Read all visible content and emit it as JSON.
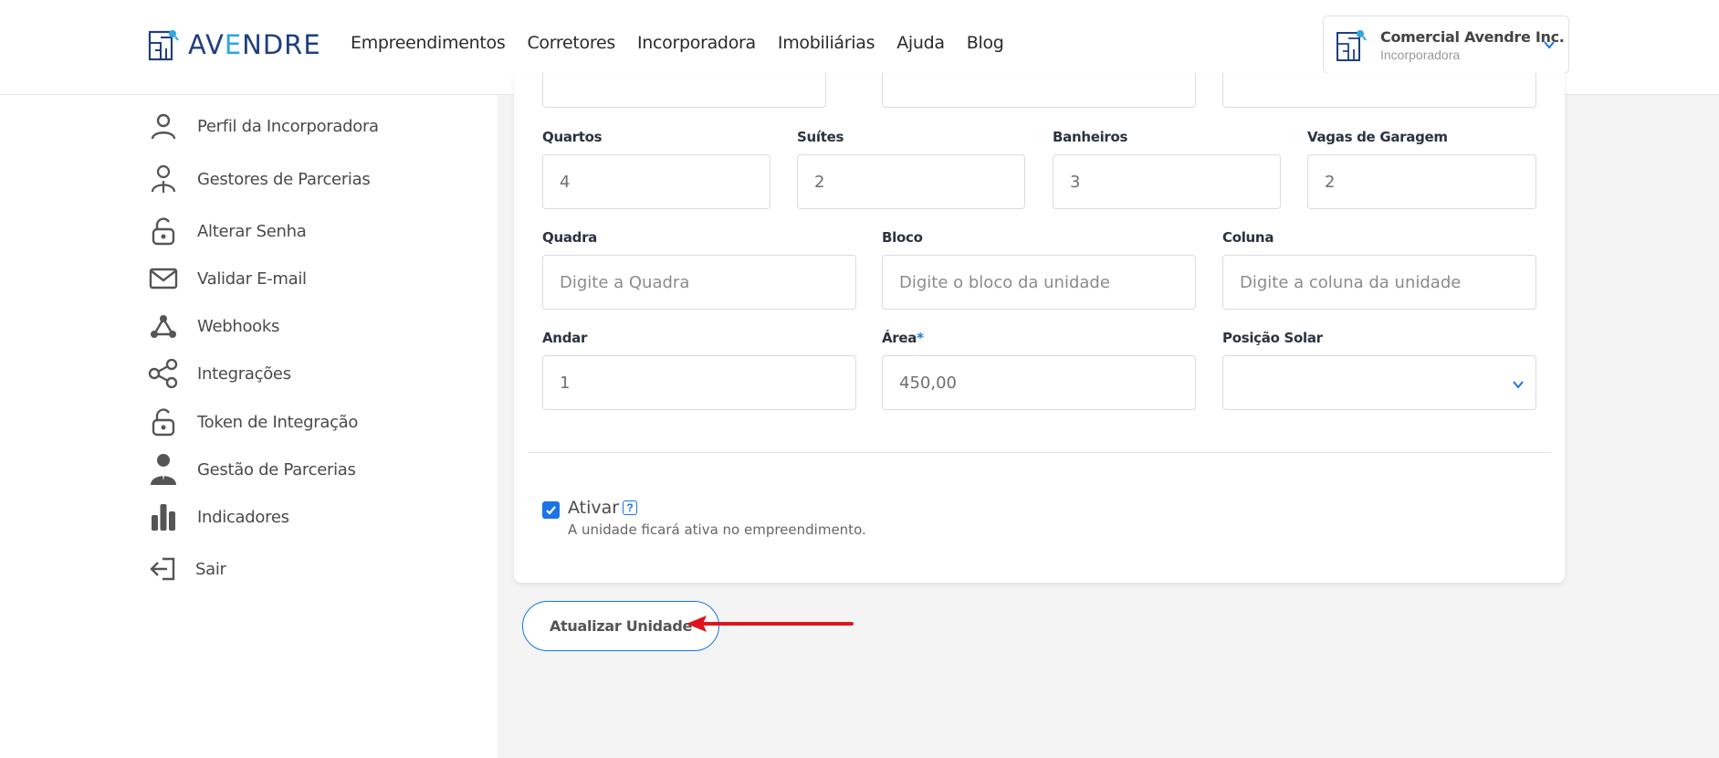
{
  "header": {
    "logo": {
      "text_main": "AV",
      "text_accent": "E",
      "text_rest": "NDRE"
    },
    "nav": [
      "Empreendimentos",
      "Corretores",
      "Incorporadora",
      "Imobiliárias",
      "Ajuda",
      "Blog"
    ],
    "account": {
      "name": "Comercial Avendre Inc.",
      "role": "Incorporadora",
      "icon": "building-icon"
    }
  },
  "sidebar": {
    "items": [
      {
        "label": "Perfil da Incorporadora",
        "icon": "user-icon"
      },
      {
        "label": "Gestores de Parcerias",
        "icon": "manager-icon"
      },
      {
        "label": "Alterar Senha",
        "icon": "lock-icon"
      },
      {
        "label": "Validar E-mail",
        "icon": "mail-icon"
      },
      {
        "label": "Webhooks",
        "icon": "webhook-icon"
      },
      {
        "label": "Integrações",
        "icon": "share-icon"
      },
      {
        "label": "Token de Integração",
        "icon": "lock-icon"
      },
      {
        "label": "Gestão de Parcerias",
        "icon": "businessman-icon"
      },
      {
        "label": "Indicadores",
        "icon": "bar-chart-icon"
      },
      {
        "label": "Sair",
        "icon": "logout-icon"
      }
    ]
  },
  "form": {
    "quartos": {
      "label": "Quartos",
      "value": "4"
    },
    "suites": {
      "label": "Suítes",
      "value": "2"
    },
    "banheiros": {
      "label": "Banheiros",
      "value": "3"
    },
    "vagas": {
      "label": "Vagas de Garagem",
      "value": "2"
    },
    "quadra": {
      "label": "Quadra",
      "placeholder": "Digite a Quadra"
    },
    "bloco": {
      "label": "Bloco",
      "placeholder": "Digite o bloco da unidade"
    },
    "coluna": {
      "label": "Coluna",
      "placeholder": "Digite a coluna da unidade"
    },
    "andar": {
      "label": "Andar",
      "value": "1"
    },
    "area": {
      "label": "Área",
      "required_mark": "*",
      "value": "450,00"
    },
    "posicao_solar": {
      "label": "Posição Solar",
      "value": ""
    },
    "ativar": {
      "label": "Ativar",
      "checked": true,
      "help": "?",
      "description": "A unidade ficará ativa no empreendimento."
    }
  },
  "actions": {
    "submit_label": "Atualizar Unidade"
  },
  "colors": {
    "primary": "#1a73e8",
    "brand_dark": "#1f3f7f",
    "brand_light": "#2da7e0",
    "annotation_arrow": "#e0141b"
  }
}
